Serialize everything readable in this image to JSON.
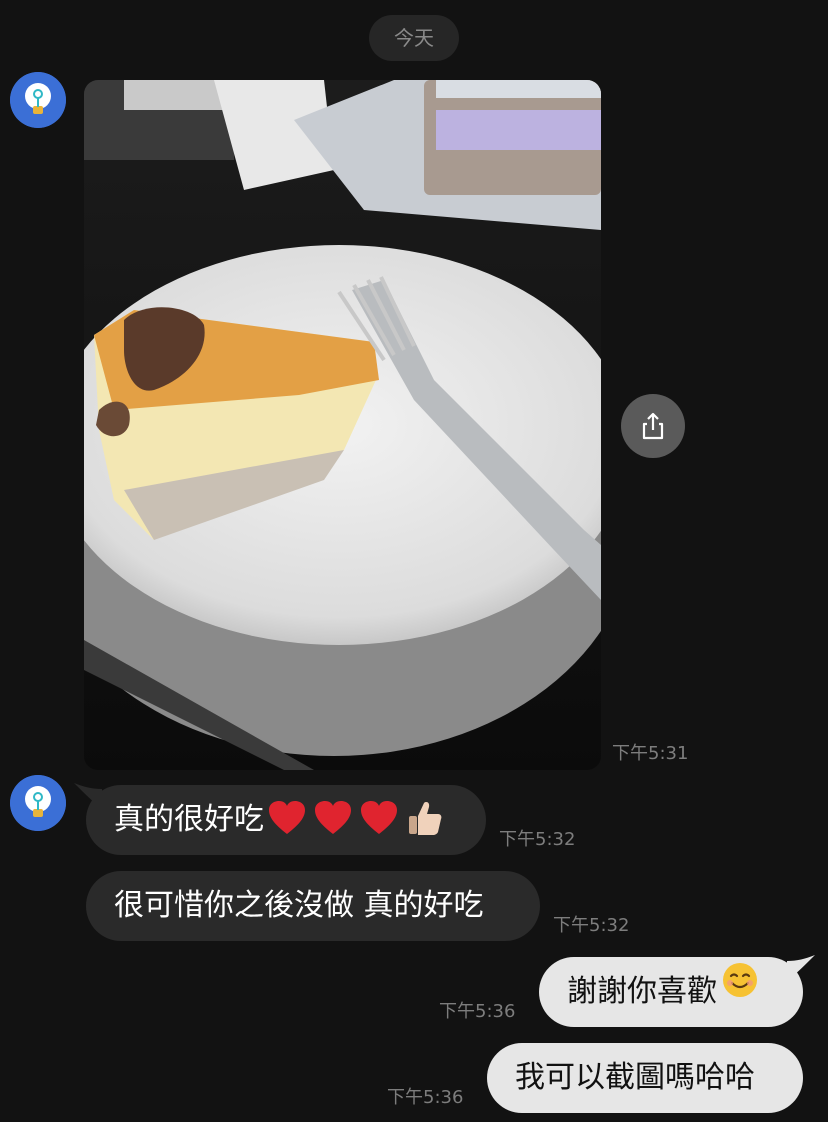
{
  "date_divider": "今天",
  "messages": [
    {
      "id": "m1",
      "type": "image",
      "direction": "incoming",
      "time": "下午5:31",
      "image_description_icon": "cheesecake-photo"
    },
    {
      "id": "m2",
      "type": "text",
      "direction": "incoming",
      "text": "真的很好吃",
      "emojis": [
        "red-heart",
        "red-heart",
        "red-heart",
        "thumbs-up"
      ],
      "time": "下午5:32"
    },
    {
      "id": "m3",
      "type": "text",
      "direction": "incoming",
      "text": "很可惜你之後沒做 真的好吃",
      "time": "下午5:32"
    },
    {
      "id": "m4",
      "type": "text",
      "direction": "outgoing",
      "text": "謝謝你喜歡",
      "emojis": [
        "smiling-face"
      ],
      "time": "下午5:36"
    },
    {
      "id": "m5",
      "type": "text",
      "direction": "outgoing",
      "text": "我可以截圖嗎哈哈",
      "time": "下午5:36"
    }
  ],
  "colors": {
    "background": "#121212",
    "incoming_bubble": "#2a2a2a",
    "outgoing_bubble": "#e6e6e6",
    "avatar": "#3b6fd6",
    "timestamp": "#7d7d7d"
  },
  "icons": {
    "avatar": "lightbulb-icon",
    "share": "share-icon"
  }
}
